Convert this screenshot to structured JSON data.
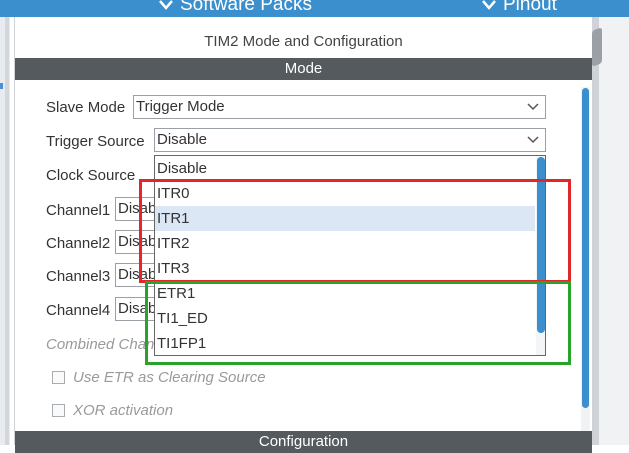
{
  "topbar": {
    "software_packs_label": "Software Packs",
    "pinout_label": "Pinout"
  },
  "panel": {
    "title": "TIM2 Mode and Configuration",
    "mode_section": "Mode",
    "configuration_section": "Configuration"
  },
  "form": {
    "slave_mode_label": "Slave Mode",
    "slave_mode_value": "Trigger Mode",
    "trigger_source_label": "Trigger Source",
    "trigger_source_value": "Disable",
    "clock_source_label": "Clock Source",
    "channel1_label": "Channel1",
    "channel1_value": "Disable",
    "channel2_label": "Channel2",
    "channel2_value": "Disable",
    "channel3_label": "Channel3",
    "channel3_value": "Disable",
    "channel4_label": "Channel4",
    "channel4_value": "Disable",
    "combined_channels_label": "Combined Channels",
    "use_etr_label": "Use ETR as Clearing Source",
    "xor_label": "XOR activation"
  },
  "dropdown": {
    "options": [
      "Disable",
      "ITR0",
      "ITR1",
      "ITR2",
      "ITR3",
      "ETR1",
      "TI1_ED",
      "TI1FP1"
    ],
    "hovered_index": 2
  },
  "colors": {
    "accent": "#3a8fcc",
    "section_bar": "#555a5e",
    "highlight_red": "#e0282a",
    "highlight_green": "#29a329"
  },
  "icons": {
    "dropdown_chevron": "chevron-down-icon",
    "topbar_chevron": "chevron-down-icon"
  }
}
